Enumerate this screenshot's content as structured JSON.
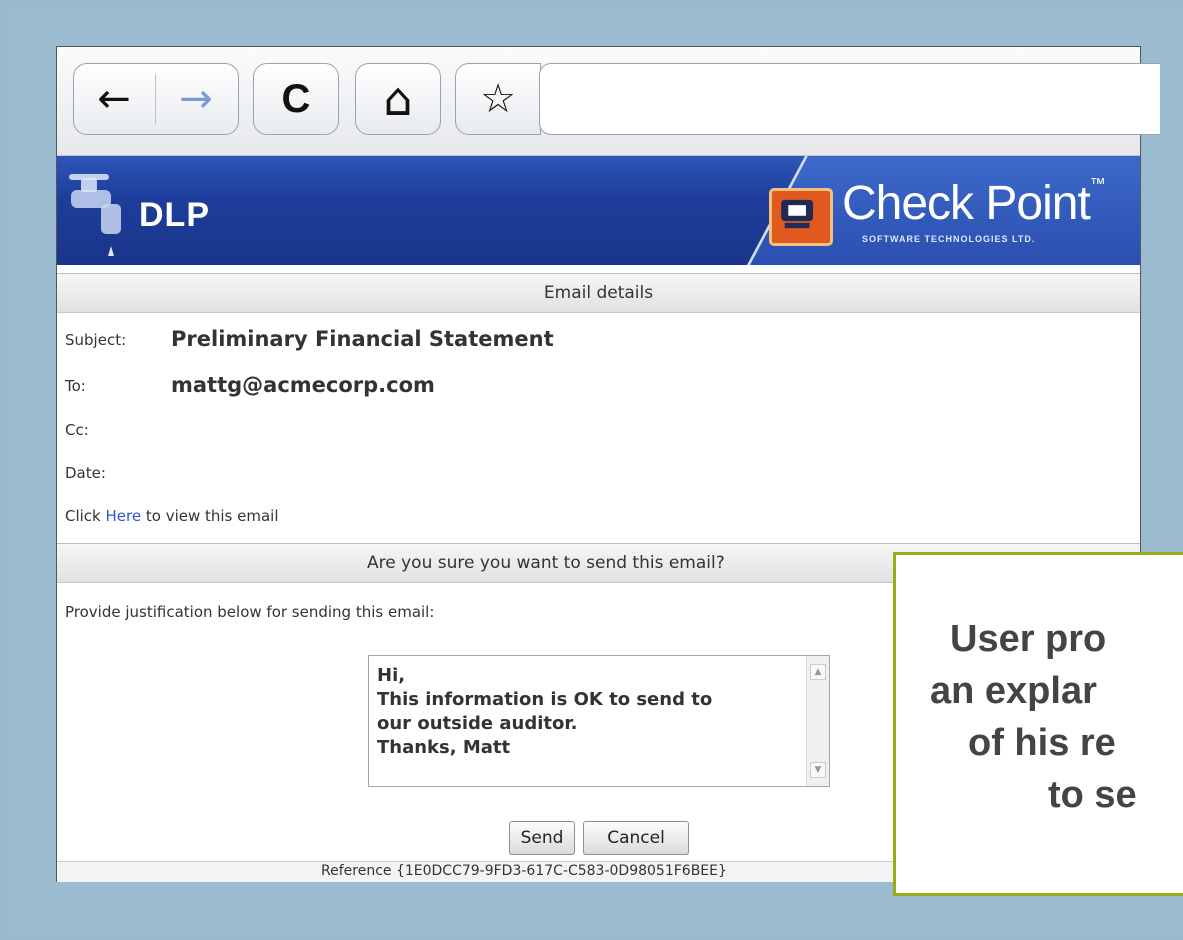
{
  "toolbar": {
    "back_icon": "back-arrow-icon",
    "forward_icon": "forward-arrow-icon",
    "reload_icon": "reload-icon",
    "home_icon": "home-icon",
    "bookmark_icon": "star-icon",
    "back_glyph": "←",
    "forward_glyph": "→",
    "reload_glyph": "C",
    "home_glyph": "⌂",
    "star_glyph": "☆",
    "url": ""
  },
  "banner": {
    "product": "DLP",
    "brand": "Check Point",
    "brand_tm": "™",
    "brand_sub": "SOFTWARE TECHNOLOGIES LTD."
  },
  "email_details": {
    "header": "Email details",
    "subject_label": "Subject:",
    "subject_value": "Preliminary Financial Statement",
    "to_label": "To:",
    "to_value": "mattg@acmecorp.com",
    "cc_label": "Cc:",
    "cc_value": "",
    "date_label": "Date:",
    "date_value": "",
    "click_prefix": "Click ",
    "click_link": "Here",
    "click_suffix": " to view this email"
  },
  "confirm": {
    "header": "Are you sure you want to send this email?",
    "prompt": "Provide justification below for sending this email:",
    "justification": "Hi,\nThis information is OK to send to\nour outside auditor.\nThanks, Matt",
    "send_label": "Send",
    "cancel_label": "Cancel",
    "reference": "Reference {1E0DCC79-9FD3-617C-C583-0D98051F6BEE}"
  },
  "callout": {
    "text": "User pro\nan explar\nof his re\nto se"
  },
  "colors": {
    "background": "#9bb8cc",
    "banner_blue": "#1d3d9a",
    "callout_border": "#9aab16",
    "link": "#3355dd"
  }
}
